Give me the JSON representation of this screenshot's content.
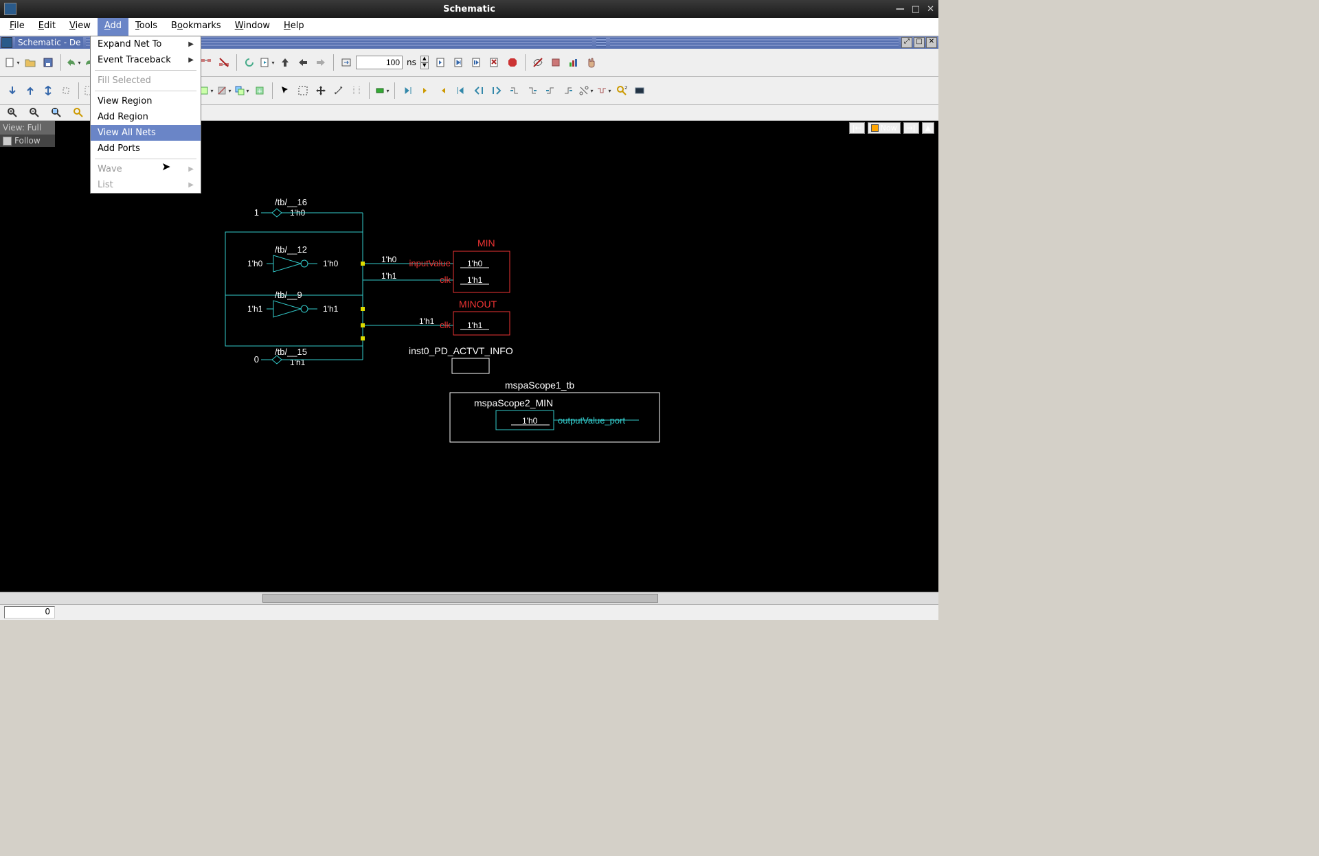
{
  "window": {
    "title": "Schematic"
  },
  "menubar": [
    "File",
    "Edit",
    "View",
    "Add",
    "Tools",
    "Bookmarks",
    "Window",
    "Help"
  ],
  "menubar_active_index": 3,
  "docbar": {
    "title": "Schematic - De"
  },
  "dropdown": {
    "items": [
      {
        "label": "Expand Net To",
        "sub": true
      },
      {
        "label": "Event Traceback",
        "sub": true
      },
      {
        "sep": true
      },
      {
        "label": "Fill Selected",
        "disabled": true
      },
      {
        "sep": true
      },
      {
        "label": "View Region"
      },
      {
        "label": "Add Region"
      },
      {
        "label": "View All Nets",
        "highlight": true
      },
      {
        "label": "Add Ports"
      },
      {
        "sep": true
      },
      {
        "label": "Wave",
        "disabled": true,
        "sub": true
      },
      {
        "label": "List",
        "disabled": true,
        "sub": true
      }
    ]
  },
  "time": {
    "value": "100",
    "unit": "ns"
  },
  "leftpanel": {
    "view": "View: Full",
    "follow": "Follow"
  },
  "badges": {
    "now": "Now"
  },
  "status": {
    "value": "0"
  },
  "schematic": {
    "n16": {
      "label": "/tb/__16",
      "const": "1",
      "val": "1'h0"
    },
    "n12": {
      "label": "/tb/__12",
      "in": "1'h0",
      "out": "1'h0"
    },
    "n9": {
      "label": "/tb/__9",
      "in": "1'h1",
      "out": "1'h1"
    },
    "n15": {
      "label": "/tb/__15",
      "const": "0",
      "val": "1'h1"
    },
    "min": {
      "title": "MIN",
      "inputValue": {
        "name": "inputValue",
        "val": "1'h0",
        "wire": "1'h0"
      },
      "clk": {
        "name": "clk",
        "val": "1'h1",
        "wire": "1'h1"
      }
    },
    "minout": {
      "title": "MINOUT",
      "clk": {
        "name": "clk",
        "val": "1'h1",
        "wire": "1'h1"
      }
    },
    "actvt": {
      "label": "inst0_PD_ACTVT_INFO"
    },
    "scope1": {
      "label": "mspaScope1_tb"
    },
    "scope2": {
      "label": "mspaScope2_MIN",
      "port": {
        "val": "1'h0",
        "name": "outputValue_port"
      }
    }
  }
}
